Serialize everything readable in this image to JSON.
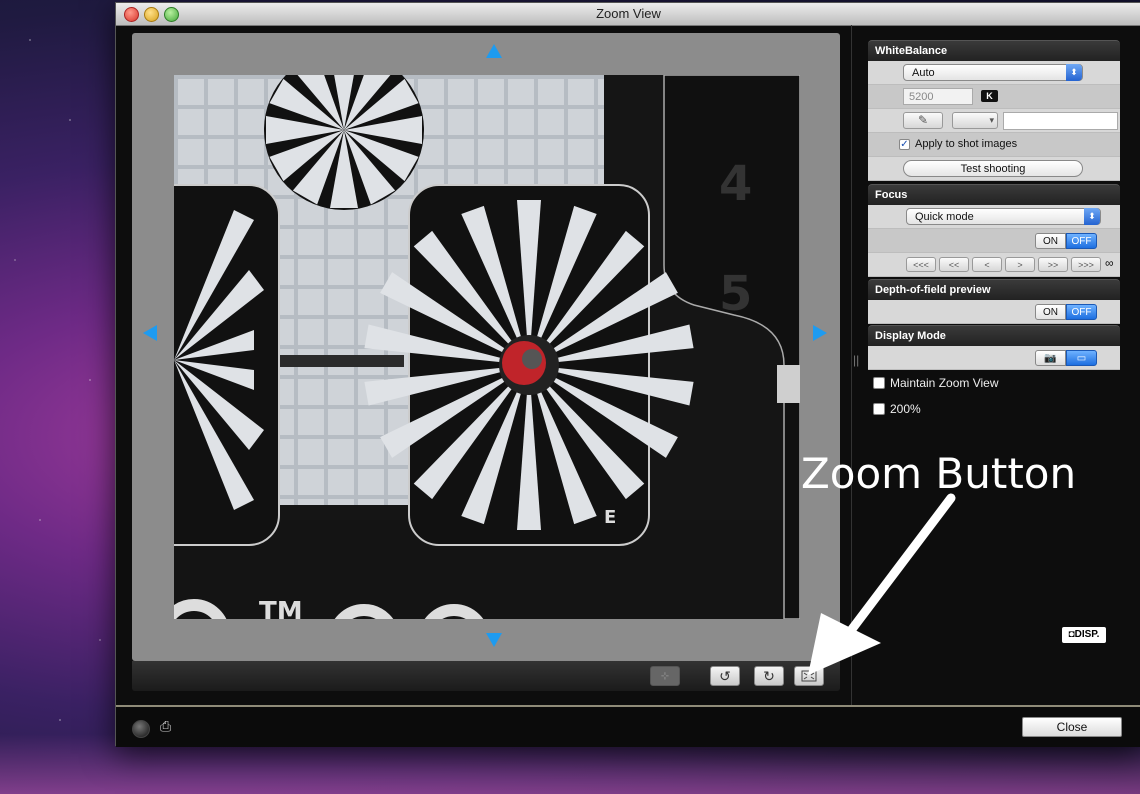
{
  "window": {
    "title": "Zoom View"
  },
  "viewer": {
    "photo_mark": "E",
    "photo_tm": "TM",
    "photo_digits": [
      "4",
      "5"
    ],
    "icons": {
      "up": "arrow-up-icon",
      "down": "arrow-down-icon",
      "left": "arrow-left-icon",
      "right": "arrow-right-icon"
    }
  },
  "toolbar": {
    "center_icon": "center-point-icon",
    "rotate_left": "↺",
    "rotate_right": "↻",
    "zoom_icon": "zoom-fit-icon"
  },
  "white_balance": {
    "title": "WhiteBalance",
    "mode": "Auto",
    "kelvin": "5200",
    "kelvin_unit": "K",
    "apply_label": "Apply to shot images",
    "apply_checked": true,
    "test_label": "Test shooting"
  },
  "focus": {
    "title": "Focus",
    "mode": "Quick mode",
    "on_label": "ON",
    "off_label": "OFF",
    "steps": [
      "<<<",
      "<<",
      "<",
      ">",
      ">>",
      ">>>"
    ],
    "infinity": "∞"
  },
  "dof": {
    "title": "Depth-of-field preview",
    "on_label": "ON",
    "off_label": "OFF"
  },
  "display_mode": {
    "title": "Display Mode"
  },
  "options": {
    "maintain_label": "Maintain Zoom View",
    "zoom200_label": "200%"
  },
  "disp_badge": "DISP.",
  "annotation": {
    "text": "Zoom Button"
  },
  "footer": {
    "close_label": "Close"
  },
  "colors": {
    "accent": "#1e9bf0",
    "off_blue": "#1d6fe0"
  }
}
